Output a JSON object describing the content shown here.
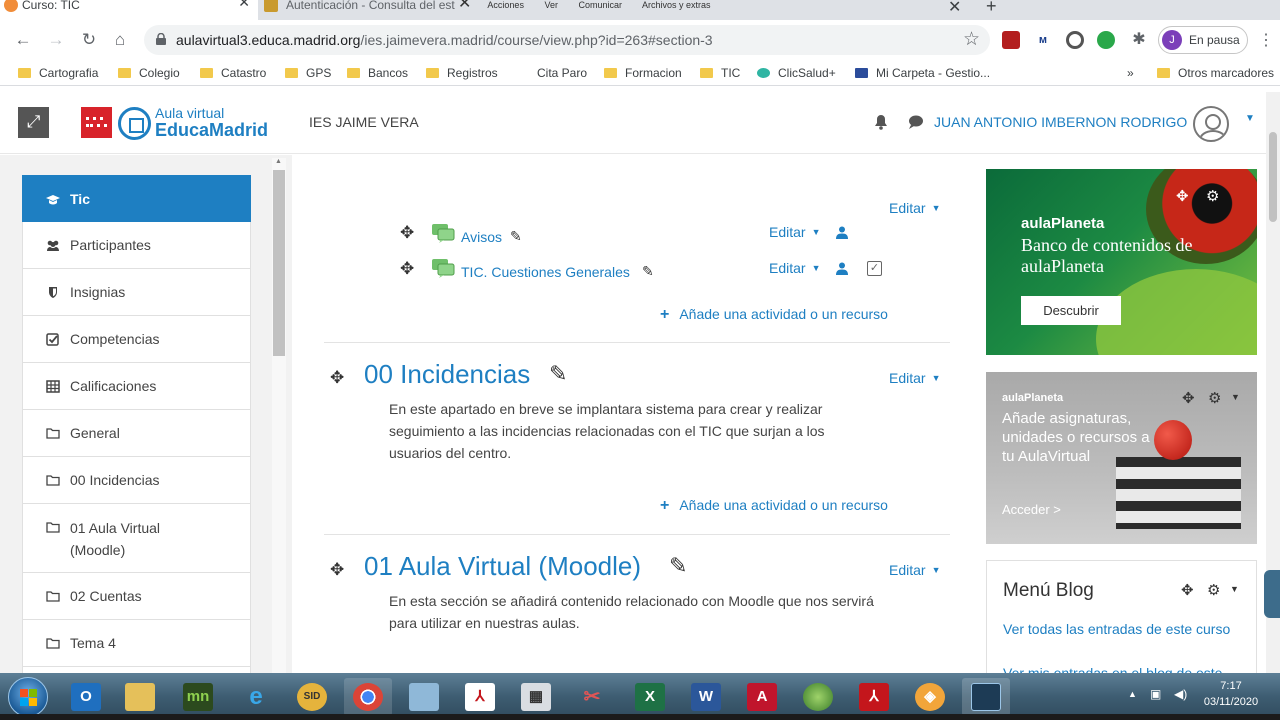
{
  "browser": {
    "tabs": [
      {
        "title": "Curso: TIC",
        "active": true
      },
      {
        "title": "Autenticación - Consulta del est",
        "active": false
      }
    ],
    "ext_popup_items": [
      "Acciones",
      "Ver",
      "Comunicar",
      "Archivos y extras"
    ],
    "url_host": "aulavirtual3.educa.madrid.org",
    "url_path": "/ies.jaimevera.madrid/course/view.php?id=263#section-3",
    "profile_initial": "J",
    "profile_status": "En pausa",
    "bookmarks": [
      "Cartografia",
      "Colegio",
      "Catastro",
      "GPS",
      "Bancos",
      "Registros",
      "Cita Paro",
      "Formacion",
      "TIC",
      "ClicSalud+",
      "Mi Carpeta - Gestio..."
    ],
    "bookmarks_overflow": "»",
    "other_bookmarks": "Otros marcadores"
  },
  "header": {
    "logo_top": "Aula virtual",
    "logo_main": "EducaMadrid",
    "school": "IES JAIME VERA",
    "user_name": "JUAN ANTONIO IMBERNON RODRIGO"
  },
  "sidebar": {
    "items": [
      {
        "label": "Tic",
        "icon": "graduation-cap-icon"
      },
      {
        "label": "Participantes",
        "icon": "users-icon"
      },
      {
        "label": "Insignias",
        "icon": "shield-icon"
      },
      {
        "label": "Competencias",
        "icon": "checkbox-icon"
      },
      {
        "label": "Calificaciones",
        "icon": "table-icon"
      },
      {
        "label": "General",
        "icon": "folder-icon"
      },
      {
        "label": "00 Incidencias",
        "icon": "folder-icon"
      },
      {
        "label": "01 Aula Virtual (Moodle)",
        "icon": "folder-icon"
      },
      {
        "label": "02 Cuentas",
        "icon": "folder-icon"
      },
      {
        "label": "Tema 4",
        "icon": "folder-icon"
      }
    ]
  },
  "main": {
    "edit_label": "Editar",
    "add_activity": "Añade una actividad o un recurso",
    "general_activities": [
      {
        "name": "Avisos"
      },
      {
        "name": "TIC. Cuestiones Generales"
      }
    ],
    "sections": [
      {
        "title": "00 Incidencias",
        "summary": "En este apartado en breve se implantara sistema para crear y realizar seguimiento a las incidencias relacionadas con el TIC que surjan a los usuarios del centro."
      },
      {
        "title": "01 Aula Virtual (Moodle)",
        "summary": "En esta sección se añadirá contenido relacionado con Moodle que nos servirá para utilizar en nuestras aulas."
      }
    ]
  },
  "blocks": {
    "banner1": {
      "brand": "aulaPlaneta",
      "title": "Banco de contenidos de aulaPlaneta",
      "button": "Descubrir"
    },
    "banner2": {
      "brand": "aulaPlaneta",
      "text": "Añade asignaturas, unidades o recursos a tu AulaVirtual",
      "button": "Acceder >"
    },
    "blog": {
      "title": "Menú Blog",
      "links": [
        "Ver todas las entradas de este curso",
        "Ver mis entradas en el blog de este"
      ]
    }
  },
  "taskbar": {
    "time": "7:17",
    "date": "03/11/2020"
  }
}
